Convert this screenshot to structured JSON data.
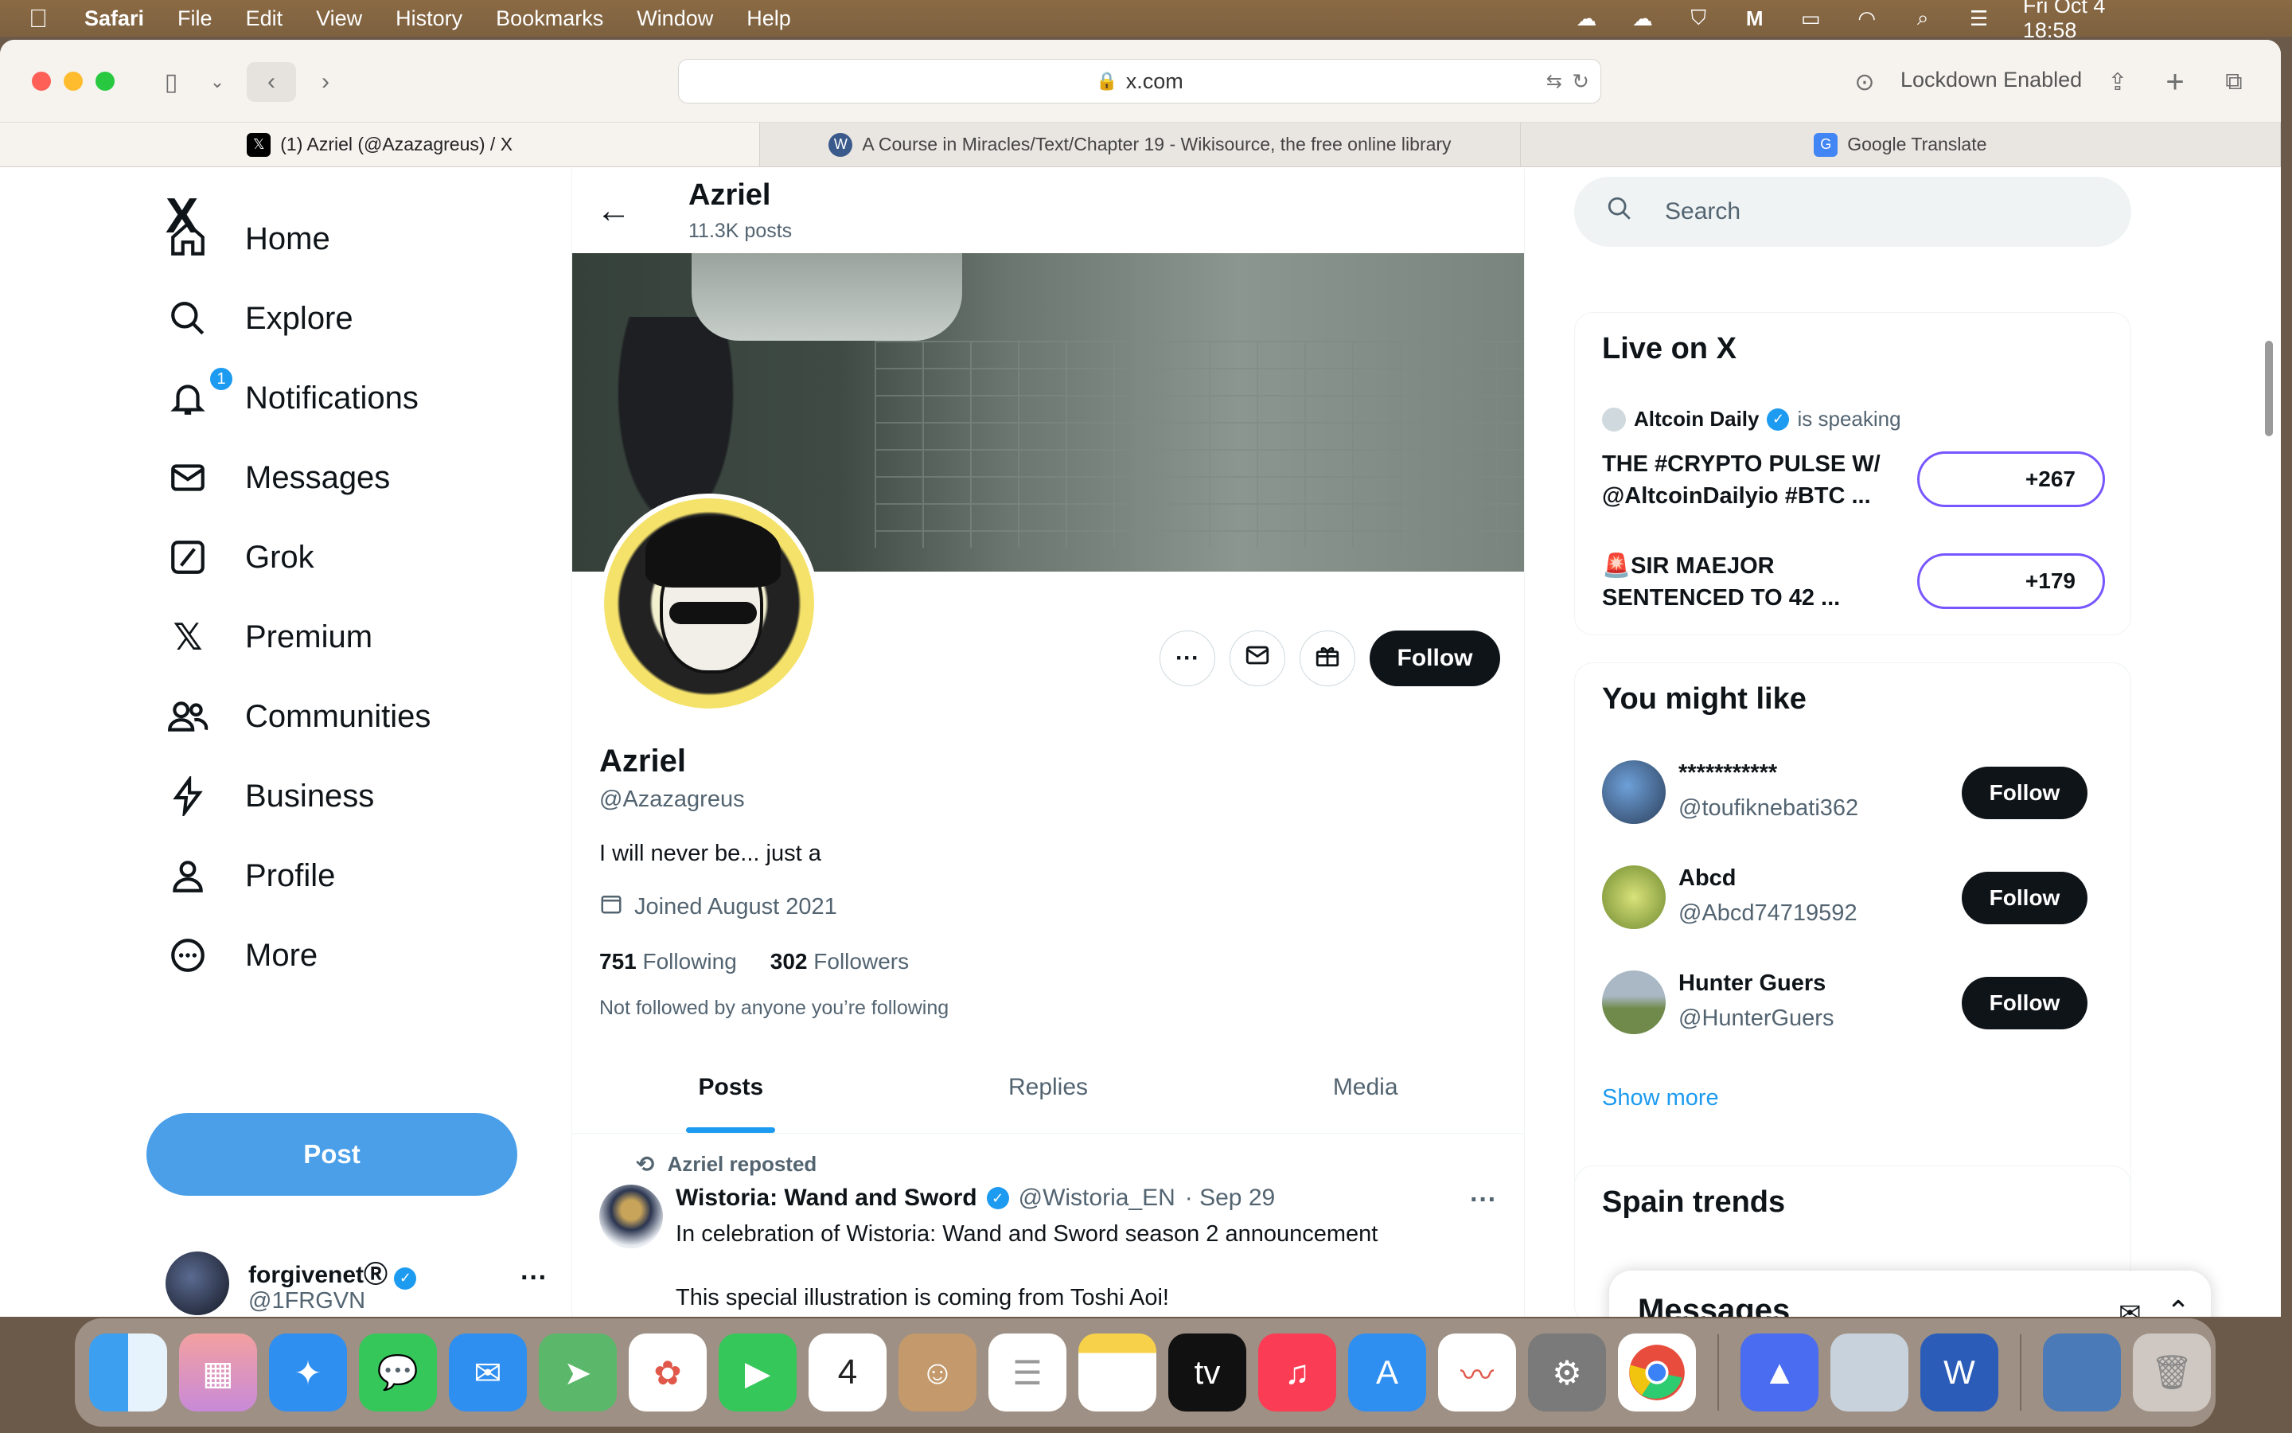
{
  "menubar": {
    "app": "Safari",
    "items": [
      "File",
      "Edit",
      "View",
      "History",
      "Bookmarks",
      "Window",
      "Help"
    ],
    "clock": "Fri Oct 4  18:58"
  },
  "browser": {
    "url": "x.com",
    "lockdown": "Lockdown Enabled",
    "tabs": [
      {
        "title": "(1) Azriel (@Azazagreus) / X",
        "icon": "x-favicon"
      },
      {
        "title": "A Course in Miracles/Text/Chapter 19 - Wikisource, the free online library",
        "icon": "wikisource-favicon"
      },
      {
        "title": "Google Translate",
        "icon": "google-translate-favicon"
      }
    ]
  },
  "nav": {
    "logo": "X",
    "items": [
      {
        "label": "Home",
        "icon": "home-icon"
      },
      {
        "label": "Explore",
        "icon": "search-icon"
      },
      {
        "label": "Notifications",
        "icon": "bell-icon",
        "badge": "1"
      },
      {
        "label": "Messages",
        "icon": "envelope-icon"
      },
      {
        "label": "Grok",
        "icon": "grok-icon"
      },
      {
        "label": "Premium",
        "icon": "x-icon"
      },
      {
        "label": "Communities",
        "icon": "people-icon"
      },
      {
        "label": "Business",
        "icon": "lightning-icon"
      },
      {
        "label": "Profile",
        "icon": "person-icon"
      },
      {
        "label": "More",
        "icon": "more-circle-icon"
      }
    ],
    "post_label": "Post",
    "account": {
      "name": "forgivenetⓇ",
      "handle": "@1FRGVN"
    }
  },
  "profile": {
    "header_name": "Azriel",
    "header_posts": "11.3K posts",
    "name": "Azriel",
    "handle": "@Azazagreus",
    "bio": "I will never be... just a",
    "joined": "Joined August 2021",
    "following_count": "751",
    "following_label": "Following",
    "followers_count": "302",
    "followers_label": "Followers",
    "not_followed": "Not followed by anyone you’re following",
    "follow_label": "Follow",
    "tabs": [
      "Posts",
      "Replies",
      "Media"
    ]
  },
  "tweet": {
    "repost_label": "Azriel reposted",
    "author": "Wistoria: Wand and Sword",
    "handle": "@Wistoria_EN",
    "date": "· Sep 29",
    "line1": "In celebration of Wistoria: Wand and Sword season 2 announcement",
    "line2": "This special illustration is coming from Toshi Aoi!"
  },
  "sidebar": {
    "search_placeholder": "Search",
    "live": {
      "title": "Live on X",
      "speaker": "Altcoin Daily",
      "speaking": "is speaking",
      "spaces": [
        {
          "title": "THE #CRYPTO PULSE W/ @AltcoinDailyio #BTC ...",
          "count": "+267"
        },
        {
          "title": "🚨SIR MAEJOR SENTENCED TO 42 ...",
          "count": "+179"
        }
      ]
    },
    "suggest": {
      "title": "You might like",
      "users": [
        {
          "name": "***********",
          "handle": "@toufiknebati362",
          "follow": "Follow"
        },
        {
          "name": "Abcd",
          "handle": "@Abcd74719592",
          "follow": "Follow"
        },
        {
          "name": "Hunter Guers",
          "handle": "@HunterGuers",
          "follow": "Follow"
        }
      ],
      "show_more": "Show more"
    },
    "trends_title": "Spain trends",
    "messages_title": "Messages"
  },
  "colors": {
    "accent": "#1d9bf0",
    "post_button": "#4a9fe8",
    "live_ring": "#7856ff"
  }
}
